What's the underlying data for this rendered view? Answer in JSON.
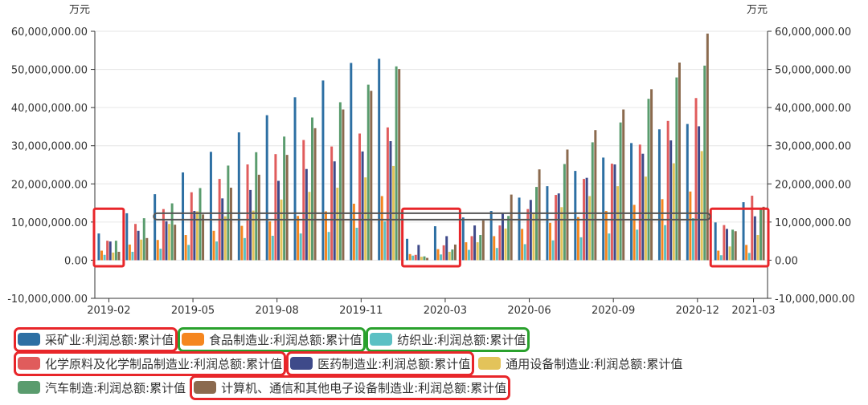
{
  "chart_data": {
    "type": "bar",
    "unit_left": "万元",
    "unit_right": "万元",
    "ylim": [
      -10000000,
      60000000
    ],
    "y_ticks": [
      "-10,000,000.00",
      "0.00",
      "10,000,000.00",
      "20,000,000.00",
      "30,000,000.00",
      "40,000,000.00",
      "50,000,000.00",
      "60,000,000.00"
    ],
    "y_tick_values": [
      -10000000,
      0,
      10000000,
      20000000,
      30000000,
      40000000,
      50000000,
      60000000
    ],
    "categories": [
      "2019-02",
      "2019-03",
      "2019-04",
      "2019-05",
      "2019-06",
      "2019-07",
      "2019-08",
      "2019-09",
      "2019-10",
      "2019-11",
      "2019-12",
      "2020-02",
      "2020-03",
      "2020-04",
      "2020-05",
      "2020-06",
      "2020-07",
      "2020-08",
      "2020-09",
      "2020-10",
      "2020-11",
      "2020-12",
      "2021-02",
      "2021-03"
    ],
    "x_tick_labels": [
      {
        "index": 0,
        "label": "2019-02"
      },
      {
        "index": 3,
        "label": "2019-05"
      },
      {
        "index": 6,
        "label": "2019-08"
      },
      {
        "index": 9,
        "label": "2019-11"
      },
      {
        "index": 12,
        "label": "2020-03"
      },
      {
        "index": 15,
        "label": "2020-06"
      },
      {
        "index": 18,
        "label": "2020-09"
      },
      {
        "index": 21,
        "label": "2020-12"
      },
      {
        "index": 23,
        "label": "2021-03"
      }
    ],
    "series": [
      {
        "name": "采矿业:利润总额:累计值",
        "color": "#2d6fa3",
        "values": [
          7000000,
          12300000,
          17300000,
          23000000,
          28400000,
          33500000,
          38000000,
          42700000,
          47100000,
          51700000,
          52800000,
          5600000,
          8900000,
          11200000,
          12900000,
          16400000,
          19400000,
          23400000,
          26900000,
          30700000,
          34300000,
          35700000,
          9900000,
          15200000
        ]
      },
      {
        "name": "食品制造业:利润总额:累计值",
        "color": "#f5861f",
        "values": [
          2500000,
          4100000,
          5300000,
          6600000,
          7700000,
          9000000,
          10200000,
          11600000,
          12800000,
          14800000,
          16800000,
          1600000,
          2900000,
          4700000,
          6300000,
          8200000,
          9800000,
          11300000,
          12900000,
          14500000,
          16000000,
          18000000,
          2500000,
          4000000
        ]
      },
      {
        "name": "纺织业:利润总额:累计值",
        "color": "#5bc0c4",
        "values": [
          1400000,
          2200000,
          3000000,
          4000000,
          4900000,
          5800000,
          6400000,
          7000000,
          7400000,
          8500000,
          10200000,
          1200000,
          1500000,
          2700000,
          3200000,
          4200000,
          5200000,
          6000000,
          7000000,
          8000000,
          9200000,
          11000000,
          1300000,
          1900000
        ]
      },
      {
        "name": "化学原料及化学制品制造业:利润总额:累计值",
        "color": "#e05c5c",
        "values": [
          5100000,
          9500000,
          13400000,
          17800000,
          21300000,
          25100000,
          27800000,
          31500000,
          29800000,
          33200000,
          34800000,
          1400000,
          3900000,
          6300000,
          9100000,
          13400000,
          17100000,
          21300000,
          25300000,
          30300000,
          36500000,
          42500000,
          9200000,
          16900000
        ]
      },
      {
        "name": "医药制造业:利润总额:累计值",
        "color": "#3e4a8a",
        "values": [
          4900000,
          7700000,
          10200000,
          12900000,
          16200000,
          18400000,
          20800000,
          23900000,
          25900000,
          28500000,
          31200000,
          4000000,
          6300000,
          9100000,
          12200000,
          15800000,
          17500000,
          21600000,
          25100000,
          27900000,
          31400000,
          35100000,
          8200000,
          11500000
        ]
      },
      {
        "name": "通用设备制造业:利润总额:累计值",
        "color": "#e3c35a",
        "values": [
          2000000,
          5400000,
          9500000,
          12800000,
          11500000,
          13000000,
          15900000,
          17900000,
          19000000,
          21700000,
          24700000,
          900000,
          2200000,
          4700000,
          8300000,
          12500000,
          13900000,
          16800000,
          19400000,
          21900000,
          25400000,
          28600000,
          3600000,
          6600000
        ]
      },
      {
        "name": "汽车制造:利润总额:累计值",
        "color": "#5a9c6e",
        "values": [
          5100000,
          11000000,
          14900000,
          18900000,
          24800000,
          28300000,
          32400000,
          37400000,
          41400000,
          46000000,
          50800000,
          1000000,
          2800000,
          6600000,
          11600000,
          19200000,
          25200000,
          30900000,
          36100000,
          42300000,
          47900000,
          51000000,
          8000000,
          13500000
        ]
      },
      {
        "name": "计算机、通信和其他电子设备制造业:利润总额:累计值",
        "color": "#8b6a4e",
        "values": [
          2200000,
          5800000,
          9300000,
          12000000,
          19000000,
          22400000,
          27600000,
          34600000,
          39500000,
          44400000,
          50100000,
          600000,
          4100000,
          10400000,
          17200000,
          23800000,
          29000000,
          34100000,
          39500000,
          44800000,
          51800000,
          59400000,
          7600000,
          14000000
        ]
      }
    ],
    "legend_rows": [
      [
        0,
        1,
        2
      ],
      [
        3,
        4,
        5
      ],
      [
        6,
        7
      ]
    ],
    "legend_placement": "bottom",
    "annotations": [
      {
        "type": "red-box",
        "target": "2019-02"
      },
      {
        "type": "red-box",
        "target": "2020-02 to 2020-03"
      },
      {
        "type": "red-box",
        "target": "2021-02 to 2021-03"
      },
      {
        "type": "rounded-rectangle-outline",
        "target": "2019-04 to 2021-01"
      },
      {
        "type": "red-box",
        "target": "legend: 采矿业"
      },
      {
        "type": "green-box",
        "target": "legend: 食品制造业"
      },
      {
        "type": "green-box",
        "target": "legend: 纺织业"
      },
      {
        "type": "red-box",
        "target": "legend: 化学原料及化学制品制造业"
      },
      {
        "type": "red-box",
        "target": "legend: 医药制造业"
      },
      {
        "type": "red-box",
        "target": "legend: 计算机、通信和其他电子设备制造业"
      }
    ],
    "annotation_colors": {
      "red": "#e8262a",
      "green": "#2aa12d",
      "rounded_outline": "#555555"
    }
  }
}
